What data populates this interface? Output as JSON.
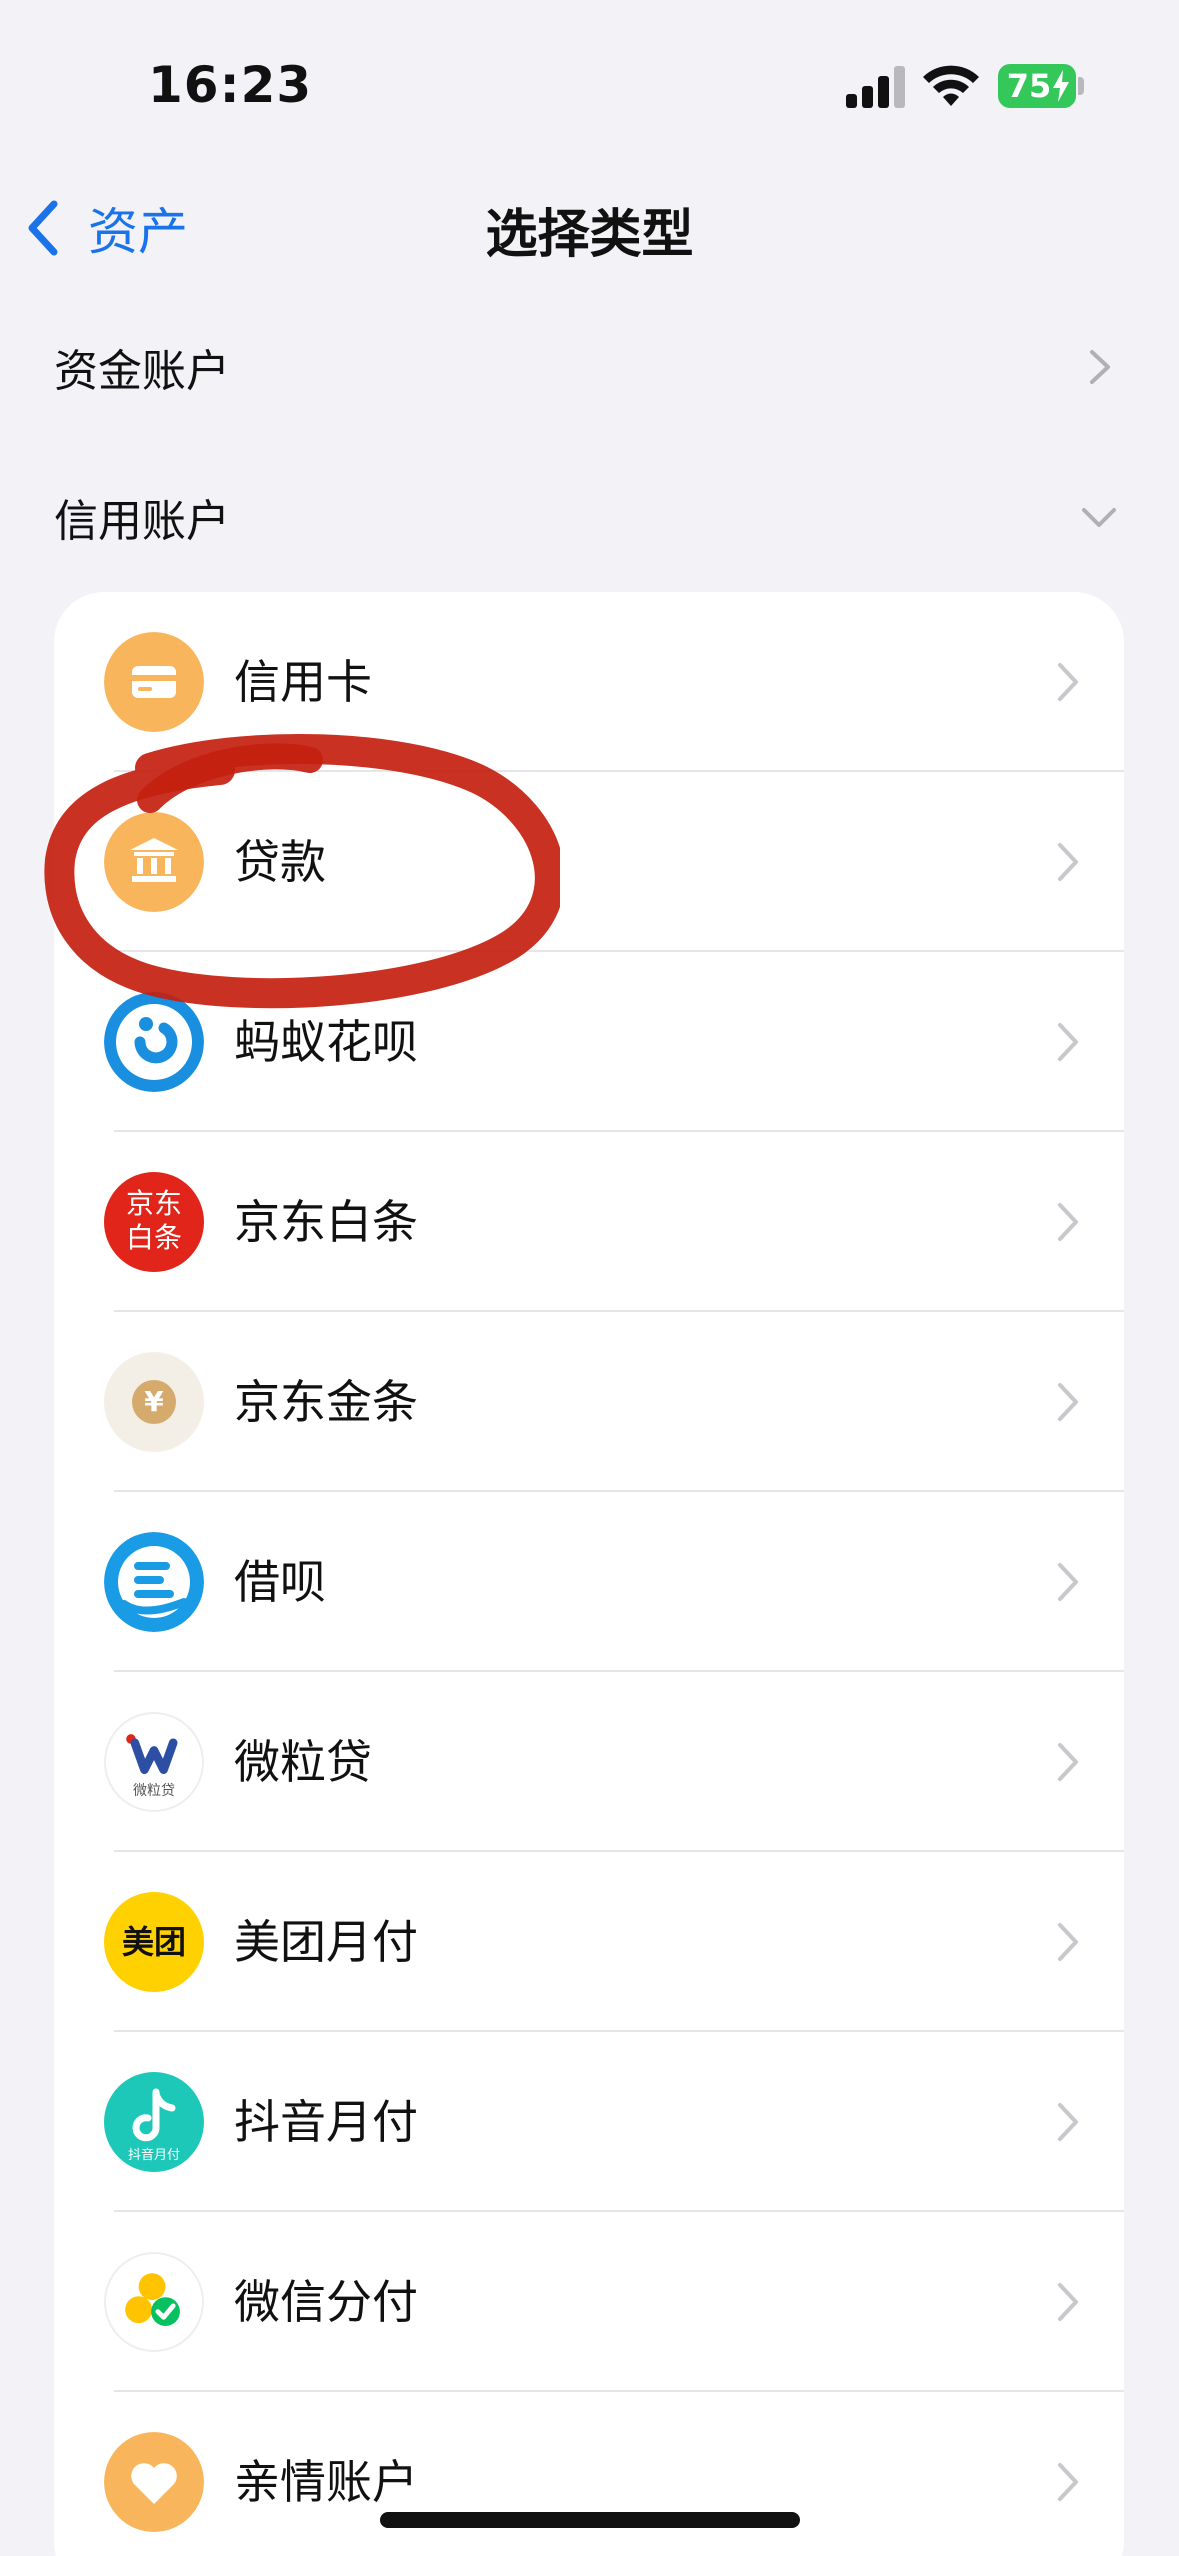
{
  "status_bar": {
    "time": "16:23",
    "battery": "75",
    "battery_color": "#34c759"
  },
  "nav": {
    "back_label": "资产",
    "title": "选择类型"
  },
  "sections": {
    "funds": {
      "label": "资金账户",
      "arrow_icon": "chevron-right-icon"
    },
    "credit": {
      "label": "信用账户",
      "arrow_icon": "chevron-down-icon"
    }
  },
  "credit_items": [
    {
      "label": "信用卡",
      "icon": "credit-card-icon"
    },
    {
      "label": "贷款",
      "icon": "bank-icon"
    },
    {
      "label": "蚂蚁花呗",
      "icon": "huabei-logo-icon"
    },
    {
      "label": "京东白条",
      "icon": "jd-baitiao-logo-icon",
      "icon_text_1": "京东",
      "icon_text_2": "白条"
    },
    {
      "label": "京东金条",
      "icon": "jd-jintiao-logo-icon",
      "icon_text_1": "¥"
    },
    {
      "label": "借呗",
      "icon": "jiebei-logo-icon"
    },
    {
      "label": "微粒贷",
      "icon": "weilidai-logo-icon",
      "icon_text_1": "微粒贷"
    },
    {
      "label": "美团月付",
      "icon": "meituan-logo-icon",
      "icon_text_1": "美团"
    },
    {
      "label": "抖音月付",
      "icon": "douyin-logo-icon",
      "icon_text_1": "抖音月付"
    },
    {
      "label": "微信分付",
      "icon": "wechat-fenfu-logo-icon"
    },
    {
      "label": "亲情账户",
      "icon": "heart-icon"
    }
  ],
  "colors": {
    "accent": "#1a73e8",
    "orange": "#f9b55b",
    "annotation": "#c4200f"
  }
}
